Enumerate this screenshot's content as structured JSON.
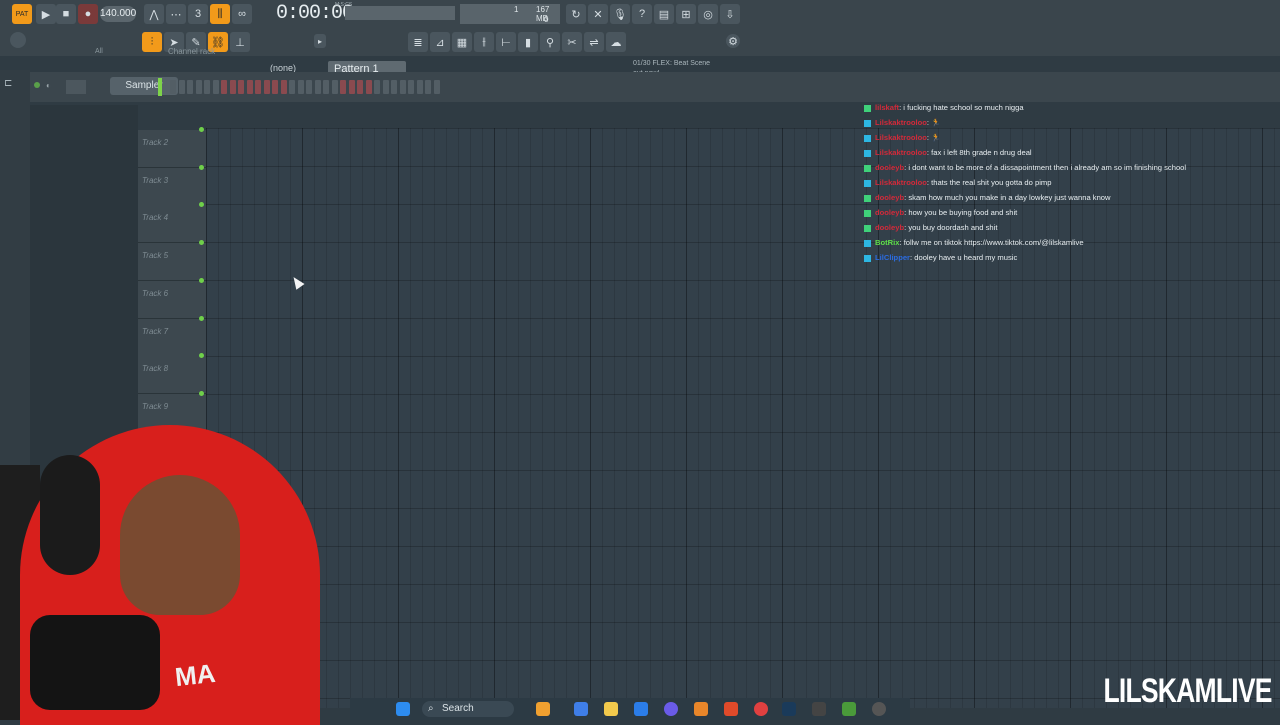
{
  "toolbar": {
    "pat_label": "PAT",
    "tempo": "140.000",
    "time": "0:00:00",
    "time_unit": "M:S:CS",
    "pattern": "Pattern 1",
    "none_option": "(none)",
    "mem_top": "1",
    "mem_value": "167 MB",
    "mem_bottom": "0",
    "hint_line1": "01/30  FLEX: Beat Scene",
    "hint_line2": "out now!"
  },
  "rack": {
    "label": "Channel rack",
    "sampler": "Sampler",
    "all_label": "All"
  },
  "tracks": [
    {
      "label": "Track 2"
    },
    {
      "label": "Track 3"
    },
    {
      "label": "Track 4"
    },
    {
      "label": "Track 5"
    },
    {
      "label": "Track 6"
    },
    {
      "label": "Track 7"
    },
    {
      "label": "Track 8"
    },
    {
      "label": "Track 9"
    }
  ],
  "chat": [
    {
      "user": "lilskaft",
      "user_color": "#d22a3a",
      "text": ": i fucking hate school so much nigga",
      "badge": "green"
    },
    {
      "user": "Lilskaktrooloo",
      "user_color": "#d22a3a",
      "text": ": ",
      "emoji": "🏃",
      "badge": "blue"
    },
    {
      "user": "Lilskaktrooloo",
      "user_color": "#d22a3a",
      "text": ": ",
      "emoji": "🏃",
      "badge": "blue"
    },
    {
      "user": "Lilskaktrooloo",
      "user_color": "#d22a3a",
      "text": ": fax i left 8th grade n drug deal",
      "badge": "blue"
    },
    {
      "user": "dooleyb",
      "user_color": "#d22a3a",
      "text": ": i dont want to be more of a dissapointment then i already am so im finishing school",
      "badge": "green"
    },
    {
      "user": "Lilskaktrooloo",
      "user_color": "#d22a3a",
      "text": ": thats the real shit you gotta do pimp",
      "badge": "blue"
    },
    {
      "user": "dooleyb",
      "user_color": "#d22a3a",
      "text": ": skam how much you make in a day lowkey just wanna know",
      "badge": "green"
    },
    {
      "user": "dooleyb",
      "user_color": "#d22a3a",
      "text": ": how you be buying food and shit",
      "badge": "green"
    },
    {
      "user": "dooleyb",
      "user_color": "#d22a3a",
      "text": ": you buy doordash and shit",
      "badge": "green"
    },
    {
      "user": "BotRix",
      "user_color": "#5fe04a",
      "text": ": follw me on tiktok https://www.tiktok.com/@lilskamlive",
      "badge": "blue"
    },
    {
      "user": "LilClipper",
      "user_color": "#2b6be0",
      "text": ": dooley have u heard my music",
      "badge": "blue"
    }
  ],
  "streamer": {
    "shirt_text": "MA"
  },
  "taskbar": {
    "search_label": "Search"
  },
  "watermark": "LILSKAMLIVE",
  "colors": {
    "accent": "#f29a1a",
    "chat_green": "#3fd17a",
    "chat_blue": "#2db7e3",
    "grid": "#33404a"
  }
}
